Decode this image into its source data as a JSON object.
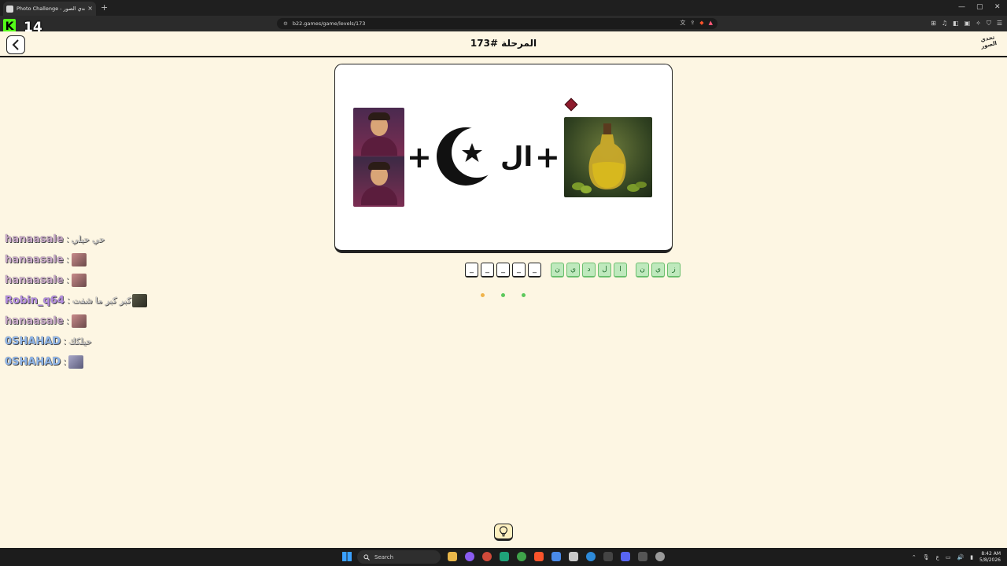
{
  "browser": {
    "tab_title": "Photo Challenge - تحدي الصور",
    "tab_close": "×",
    "new_tab": "+",
    "url": "b22.games/game/levels/173",
    "window_controls": [
      "—",
      "▢",
      "✕"
    ]
  },
  "stream_overlay": {
    "k_logo": "K",
    "number": "14"
  },
  "header": {
    "level_title": "المرحلة #173",
    "logo_text": "تحدي الصور"
  },
  "puzzle": {
    "al_text": "ال",
    "plus_sign": "+"
  },
  "answer": {
    "slots": [
      "_",
      "_",
      "_",
      "_",
      "_"
    ]
  },
  "letters": {
    "group_1": [
      "ن",
      "ي",
      "د",
      "ل",
      "ا"
    ],
    "group_2": [
      "ن",
      "ي",
      "ز"
    ]
  },
  "progress_dots": [
    {
      "color": "#f0b34a"
    },
    {
      "color": "#5cc85c"
    },
    {
      "color": "#5cc85c"
    }
  ],
  "chat": [
    {
      "user": "hanaasale",
      "message": "حي حيلي",
      "emote": false
    },
    {
      "user": "hanaasale",
      "message": "",
      "emote": true
    },
    {
      "user": "hanaasale",
      "message": "",
      "emote": true
    },
    {
      "user": "Robin_q64",
      "message": "كبر كبر ما شفت",
      "emote": true
    },
    {
      "user": "hanaasale",
      "message": "",
      "emote": true
    },
    {
      "user": "0SHAHAD",
      "message": "حيلكك",
      "emote": false
    },
    {
      "user": "0SHAHAD",
      "message": "",
      "emote": true
    }
  ],
  "taskbar": {
    "search_label": "Search",
    "time": "8:42 AM",
    "date": "5/8/2026"
  },
  "colors": {
    "page_bg": "#fdf6e3",
    "letter_tile": "#bfe9bd",
    "accent_dark": "#111111"
  }
}
